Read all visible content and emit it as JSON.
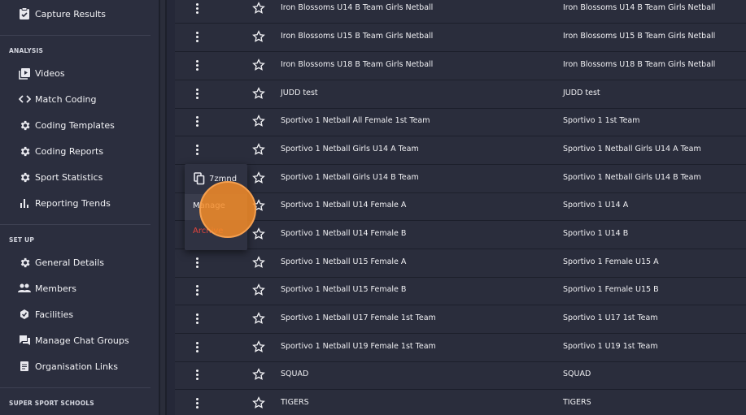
{
  "sidebar": {
    "top_item": {
      "label": "Capture Results",
      "icon": "clipboard-check-icon"
    },
    "sections": [
      {
        "title": "ANALYSIS"
      },
      {
        "title": "SET UP"
      },
      {
        "title": "SUPER SPORT SCHOOLS"
      }
    ],
    "analysis_items": [
      {
        "label": "Videos",
        "icon": "video-library-icon"
      },
      {
        "label": "Match Coding",
        "icon": "code-icon"
      },
      {
        "label": "Coding Templates",
        "icon": "gear-icon"
      },
      {
        "label": "Coding Reports",
        "icon": "gear-icon"
      },
      {
        "label": "Sport Statistics",
        "icon": "gear-icon"
      },
      {
        "label": "Reporting Trends",
        "icon": "bar-chart-icon"
      }
    ],
    "setup_items": [
      {
        "label": "General Details",
        "icon": "gear-icon"
      },
      {
        "label": "Members",
        "icon": "people-icon"
      },
      {
        "label": "Facilities",
        "icon": "facility-icon"
      },
      {
        "label": "Manage Chat Groups",
        "icon": "chat-icon"
      },
      {
        "label": "Organisation Links",
        "icon": "document-icon"
      }
    ]
  },
  "table": {
    "rows": [
      {
        "name": "Iron Blossoms U14 B Team Girls Netball",
        "display": "Iron Blossoms U14 B Team Girls Netball"
      },
      {
        "name": "Iron Blossoms U15 B Team Girls Netball",
        "display": "Iron Blossoms U15 B Team Girls Netball"
      },
      {
        "name": "Iron Blossoms U18 B Team Girls Netball",
        "display": "Iron Blossoms U18 B Team Girls Netball"
      },
      {
        "name": "JUDD test",
        "display": "JUDD test"
      },
      {
        "name": "Sportivo 1 Netball All Female 1st Team",
        "display": "Sportivo 1 1st Team"
      },
      {
        "name": "Sportivo 1 Netball Girls U14 A Team",
        "display": "Sportivo 1 Netball Girls U14 A Team"
      },
      {
        "name": "Sportivo 1 Netball Girls U14 B Team",
        "display": "Sportivo 1 Netball Girls U14 B Team"
      },
      {
        "name": "Sportivo 1 Netball U14 Female A",
        "display": "Sportivo 1 U14 A"
      },
      {
        "name": "Sportivo 1 Netball U14 Female B",
        "display": "Sportivo 1 U14 B"
      },
      {
        "name": "Sportivo 1 Netball U15 Female A",
        "display": "Sportivo 1 Female U15 A"
      },
      {
        "name": "Sportivo 1 Netball U15 Female B",
        "display": "Sportivo 1 Female U15 B"
      },
      {
        "name": "Sportivo 1 Netball U17 Female 1st Team",
        "display": "Sportivo 1 U17 1st Team"
      },
      {
        "name": "Sportivo 1 Netball U19 Female 1st Team",
        "display": "Sportivo 1 U19 1st Team"
      },
      {
        "name": "SQUAD",
        "display": "SQUAD"
      },
      {
        "name": "TIGERS",
        "display": "TIGERS"
      }
    ]
  },
  "context_menu": {
    "copy_label": "7zmnd",
    "manage_label": "Manage",
    "archive_label": "Archive",
    "archive_color": "#e2443c"
  },
  "colors": {
    "sidebar_bg": "#2b2e3e",
    "main_bg": "#2a2d3c",
    "accent_orange": "#f58c28"
  }
}
